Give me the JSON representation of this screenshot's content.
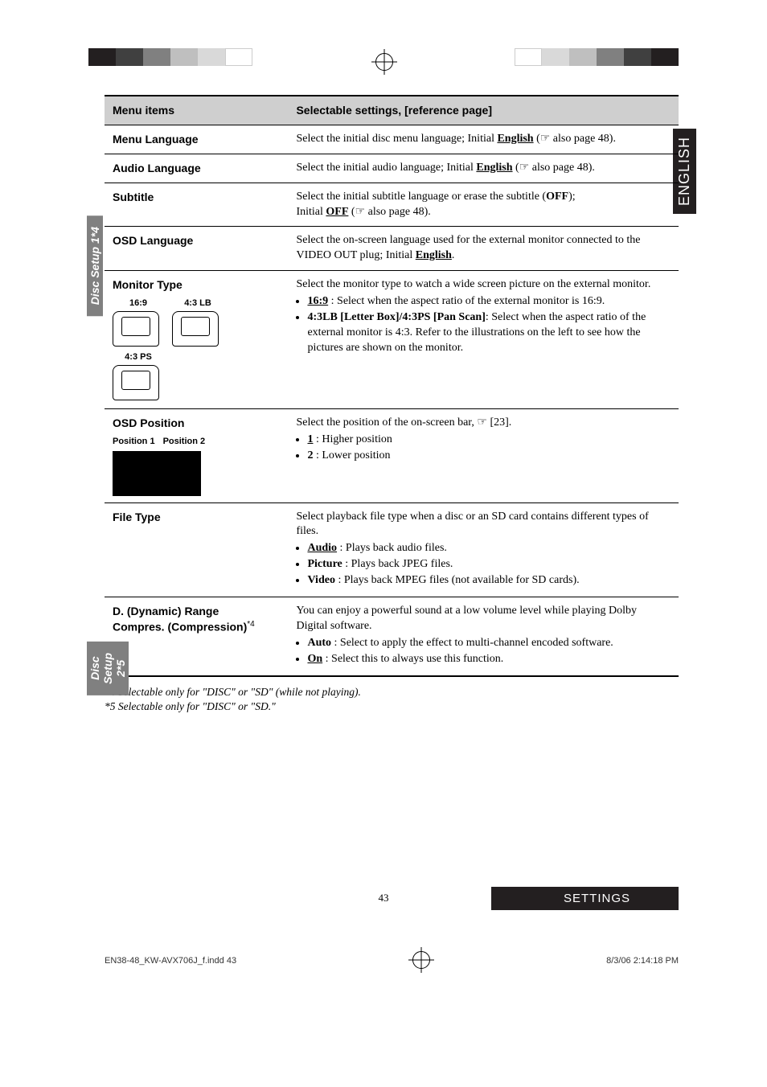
{
  "side_tab": "ENGLISH",
  "table": {
    "header": {
      "col1": "Menu items",
      "col2": "Selectable settings, [reference page]"
    },
    "group1_label": "Disc Setup 1*4",
    "group2_label": "Disc Setup 2*5",
    "rows": {
      "menu_language": {
        "title": "Menu Language",
        "desc_pre": "Select the initial disc menu language; Initial ",
        "desc_bold": "English",
        "desc_post": " (☞ also page 48)."
      },
      "audio_language": {
        "title": "Audio Language",
        "desc_pre": "Select the initial audio language; Initial ",
        "desc_bold": "English",
        "desc_post": " (☞ also page 48)."
      },
      "subtitle": {
        "title": "Subtitle",
        "desc_l1_pre": "Select the initial subtitle language or erase the subtitle (",
        "desc_l1_b": "OFF",
        "desc_l1_post": ");",
        "desc_l2_pre": "Initial ",
        "desc_l2_b": "OFF",
        "desc_l2_post": " (☞ also page 48)."
      },
      "osd_language": {
        "title": "OSD Language",
        "desc_pre": "Select the on-screen language used for the external monitor connected to the VIDEO OUT plug; Initial ",
        "desc_bold": "English",
        "desc_post": "."
      },
      "monitor_type": {
        "title": "Monitor Type",
        "labels": {
          "a": "16:9",
          "b": "4:3 LB",
          "c": "4:3 PS"
        },
        "desc_l1": "Select the monitor type to watch a wide screen picture on the external monitor.",
        "b1_b": "16:9",
        "b1_post": " : Select when the aspect ratio of the external monitor is 16:9.",
        "b2_b": "4:3LB [Letter Box]/4:3PS [Pan Scan]",
        "b2_post": ": Select when the aspect ratio of the external monitor is 4:3. Refer to the illustrations on the left to see how the pictures are shown on the monitor."
      },
      "osd_position": {
        "title": "OSD Position",
        "labels": {
          "p1": "Position 1",
          "p2": "Position 2"
        },
        "desc_l1": "Select the position of the on-screen bar, ☞ [23].",
        "b1_b": "1",
        "b1_post": " :  Higher position",
        "b2_b": "2",
        "b2_post": " :  Lower position"
      },
      "file_type": {
        "title": "File Type",
        "desc_l1": "Select playback file type when a disc or an SD card contains different types of files.",
        "b1_b": "Audio",
        "b1_post": " : Plays back audio files.",
        "b2_b": "Picture",
        "b2_post": " :  Plays back JPEG files.",
        "b3_b": "Video",
        "b3_post": " : Plays back MPEG files (not available for SD cards)."
      },
      "d_range": {
        "title_l1": "D. (Dynamic) Range",
        "title_l2_pre": "Compres. (Compression)",
        "title_l2_sup": "*4",
        "desc_l1": "You can enjoy a powerful sound at a low volume level while playing Dolby Digital software.",
        "b1_b": "Auto",
        "b1_post": " : Select to apply the effect to multi-channel encoded software.",
        "b2_b": "On",
        "b2_post": " : Select this to always use this function."
      }
    }
  },
  "footnotes": {
    "f4": "*4  Selectable only for \"DISC\" or \"SD\" (while not playing).",
    "f5": "*5  Selectable only for \"DISC\" or \"SD.\""
  },
  "page_number": "43",
  "footer_box": "SETTINGS",
  "print_meta": {
    "left": "EN38-48_KW-AVX706J_f.indd   43",
    "right": "8/3/06   2:14:18 PM"
  }
}
